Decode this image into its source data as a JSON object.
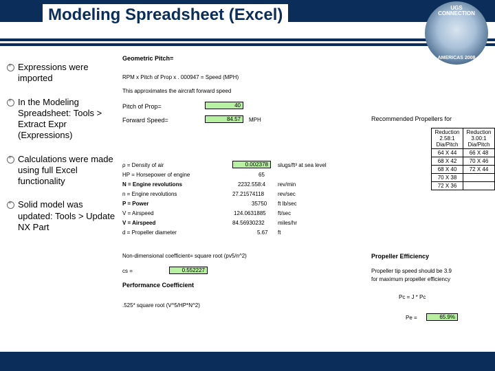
{
  "header": {
    "title": "Modeling Spreadsheet (Excel)",
    "logo_top1": "UGS",
    "logo_top2": "CONNECTION",
    "logo_bot": "AMERICAS 2008"
  },
  "bullets": [
    "Expressions were imported",
    "In the Modeling Spreadsheet: Tools > Extract Expr (Expressions)",
    "Calculations were made using full Excel functionality",
    "Solid model was updated: Tools > Update NX Part"
  ],
  "sheet": {
    "geom_pitch_label": "Geometric Pitch=",
    "formula": "RPM x Pitch of Prop x . 000947 = Speed (MPH)",
    "approx": "This approximates the aircraft forward speed",
    "pitch_label": "Pitch of Prop=",
    "pitch_val": "40",
    "fwd_label": "Forward Speed=",
    "fwd_val": "84.57",
    "fwd_unit": "MPH",
    "rec_prop": "Recommended Propellers for",
    "legend": [
      "ρ = Density of air",
      "HP = Horsepower of engine",
      "N = Engine revolutions",
      "n = Engine revolutions",
      "P = Power",
      "V = Airspeed",
      "V = Airspeed",
      "d = Propeller diameter"
    ],
    "vals": [
      "0.002378",
      "65",
      "2232.558:4",
      "27.21574118",
      "35750",
      "124.0631885",
      "84.56930232",
      "5.67"
    ],
    "units": [
      "slugs/ft³ at sea level",
      "",
      "rev/min",
      "rev/sec",
      "ft lb/sec",
      "ft/sec",
      "miles/hr",
      "ft"
    ],
    "prop_table_hdr": [
      "Reduction 2.58:1 Dia/Pitch",
      "Reduction 3.00:1 Dia/Pitch"
    ],
    "prop_table_rows": [
      [
        "64 X 44",
        "66 X 48"
      ],
      [
        "68 X 42",
        "70 X 46"
      ],
      [
        "68 X 40",
        "72 X 44"
      ],
      [
        "70 X 38",
        ""
      ],
      [
        "72 X 36",
        ""
      ]
    ],
    "nondim_label": "Non-dimensional coefficient= square root (pv5/n^2)",
    "cs_label": "cs =",
    "cs_val": "0.552227",
    "perf_label": "Performance Coefficient",
    "perf_note": ".525* square root (V^5/HP*N^2)",
    "eff_title": "Propeller Efficiency",
    "eff_note1": "Propeller tip speed should be 3.9",
    "eff_note2": "for maximum propeller efficiency",
    "pc_label": "Pc = J * Pc",
    "pe_label": "Pe =",
    "pe_val": "65.9%"
  }
}
